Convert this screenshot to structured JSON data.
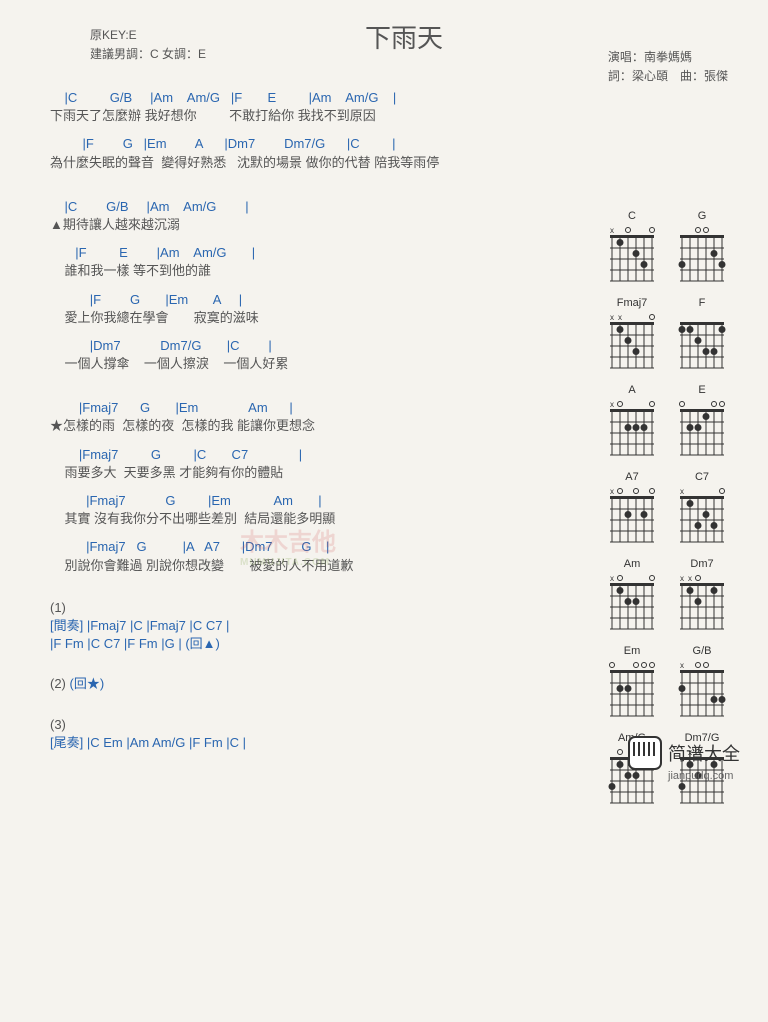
{
  "header": {
    "title": "下雨天",
    "original_key": "原KEY:E",
    "suggest": "建議男調：C 女調：E",
    "singer_label": "演唱：",
    "singer": "南拳媽媽",
    "lyrics_label": "詞：",
    "lyricist": "梁心頤",
    "music_label": "曲：",
    "composer": "張傑"
  },
  "lines": [
    {
      "c": "    |C         G/B     |Am    Am/G   |F       E         |Am    Am/G    |",
      "l": "下雨天了怎麼辦 我好想你         不敢打給你 我找不到原因"
    },
    {
      "c": "         |F        G   |Em        A      |Dm7        Dm7/G      |C         |",
      "l": "為什麼失眠的聲音  變得好熟悉   沈默的場景 做你的代替 陪我等雨停"
    },
    {
      "gap": true
    },
    {
      "c": "    |C        G/B     |Am    Am/G        |",
      "l": "▲期待讓人越來越沉溺"
    },
    {
      "c": "       |F         E        |Am    Am/G       |",
      "l": "    誰和我一樣 等不到他的誰"
    },
    {
      "c": "           |F        G       |Em       A     |",
      "l": "    愛上你我總在學會       寂寞的滋味"
    },
    {
      "c": "           |Dm7           Dm7/G       |C        |",
      "l": "    一個人撐傘    一個人擦淚    一個人好累"
    },
    {
      "gap": true
    },
    {
      "c": "        |Fmaj7      G       |Em              Am      |",
      "l": "★怎樣的雨  怎樣的夜  怎樣的我 能讓你更想念"
    },
    {
      "c": "        |Fmaj7         G         |C       C7              |",
      "l": "    雨要多大  天要多黑 才能夠有你的體貼"
    },
    {
      "c": "          |Fmaj7           G         |Em            Am       |",
      "l": "    其實 沒有我你分不出哪些差別  結局還能多明顯"
    },
    {
      "c": "          |Fmaj7   G          |A   A7      |Dm7        G    |",
      "l": "    別說你會難過 別說你想改變       被愛的人不用道歉"
    }
  ],
  "flows": [
    {
      "n": "(1)",
      "pre": "[間奏]",
      "seq": "  |Fmaj7    |C          |Fmaj7       |C  C7   |",
      "seq2": "          |F    Fm    |C    C7   |F     Fm    |G        |  (回▲)"
    },
    {
      "n": "(2)",
      "pre": "",
      "seq": " (回★)",
      "seq2": ""
    },
    {
      "n": "(3)",
      "pre": "[尾奏]",
      "seq": "  |C    Em    |Am    Am/G    |F    Fm    |C     |",
      "seq2": ""
    }
  ],
  "diagrams": [
    "C",
    "G",
    "Fmaj7",
    "F",
    "A",
    "E",
    "A7",
    "C7",
    "Am",
    "Dm7",
    "Em",
    "G/B",
    "Am/G",
    "Dm7/G"
  ],
  "footer": {
    "brand": "简谱大全",
    "url": "jianpudq.com"
  },
  "watermark": "木木吉他"
}
